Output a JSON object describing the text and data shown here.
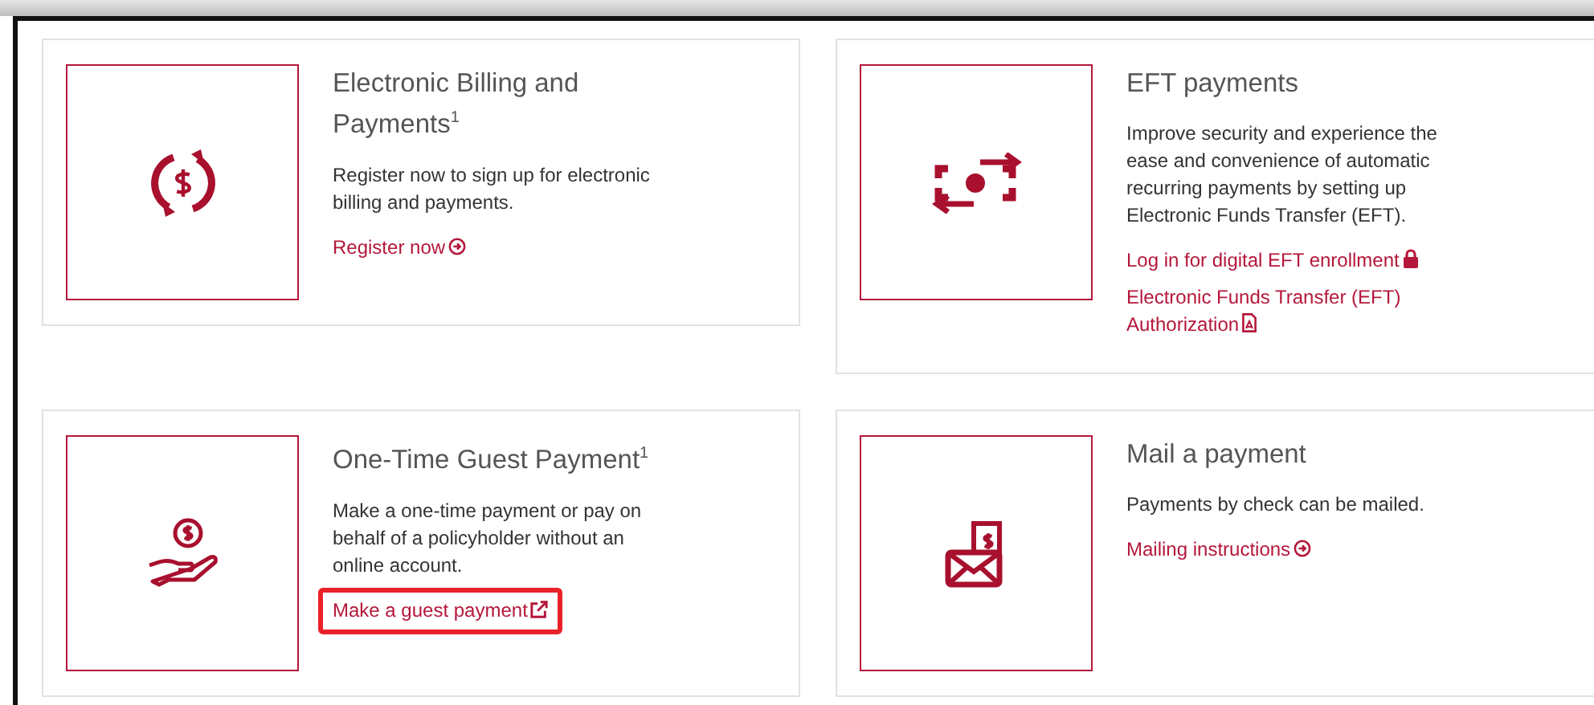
{
  "cards": [
    {
      "title": "Electronic Billing and Payments$^{1}$",
      "description": "Register now to sign up for electronic billing and payments.",
      "links": [
        {
          "label": "Register now",
          "kind": "arrow",
          "highlighted": false
        }
      ]
    },
    {
      "title": "EFT payments",
      "description": "Improve security and experience the ease and convenience of automatic recurring payments by setting up Electronic Funds Transfer (EFT).",
      "links": [
        {
          "label": "Log in for digital EFT enrollment",
          "kind": "lock",
          "highlighted": false
        },
        {
          "label": "Electronic Funds Transfer (EFT) Authorization",
          "kind": "pdf",
          "highlighted": false
        }
      ]
    },
    {
      "title": "One-Time Guest Payment$^{1}$",
      "description": "Make a one-time payment or pay on behalf of a policyholder without an online account.",
      "links": [
        {
          "label": "Make a guest payment",
          "kind": "external",
          "highlighted": true
        }
      ]
    },
    {
      "title": "Mail a payment",
      "description": "Payments by check can be mailed.",
      "links": [
        {
          "label": "Mailing instructions",
          "kind": "arrow",
          "highlighted": false
        }
      ]
    }
  ]
}
